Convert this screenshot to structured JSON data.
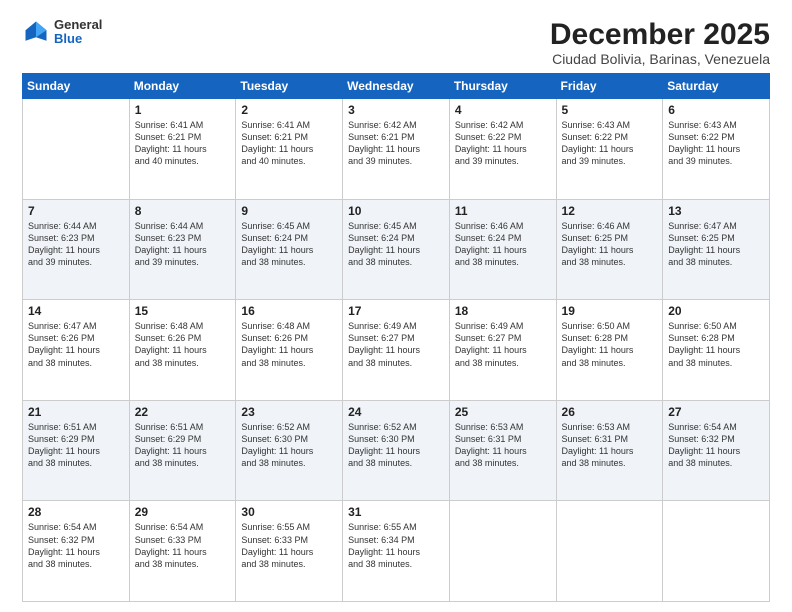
{
  "logo": {
    "general": "General",
    "blue": "Blue"
  },
  "title": "December 2025",
  "location": "Ciudad Bolivia, Barinas, Venezuela",
  "days_of_week": [
    "Sunday",
    "Monday",
    "Tuesday",
    "Wednesday",
    "Thursday",
    "Friday",
    "Saturday"
  ],
  "weeks": [
    [
      {
        "day": "",
        "sunrise": "",
        "sunset": "",
        "daylight": ""
      },
      {
        "day": "1",
        "sunrise": "Sunrise: 6:41 AM",
        "sunset": "Sunset: 6:21 PM",
        "daylight": "Daylight: 11 hours and 40 minutes."
      },
      {
        "day": "2",
        "sunrise": "Sunrise: 6:41 AM",
        "sunset": "Sunset: 6:21 PM",
        "daylight": "Daylight: 11 hours and 40 minutes."
      },
      {
        "day": "3",
        "sunrise": "Sunrise: 6:42 AM",
        "sunset": "Sunset: 6:21 PM",
        "daylight": "Daylight: 11 hours and 39 minutes."
      },
      {
        "day": "4",
        "sunrise": "Sunrise: 6:42 AM",
        "sunset": "Sunset: 6:22 PM",
        "daylight": "Daylight: 11 hours and 39 minutes."
      },
      {
        "day": "5",
        "sunrise": "Sunrise: 6:43 AM",
        "sunset": "Sunset: 6:22 PM",
        "daylight": "Daylight: 11 hours and 39 minutes."
      },
      {
        "day": "6",
        "sunrise": "Sunrise: 6:43 AM",
        "sunset": "Sunset: 6:22 PM",
        "daylight": "Daylight: 11 hours and 39 minutes."
      }
    ],
    [
      {
        "day": "7",
        "sunrise": "Sunrise: 6:44 AM",
        "sunset": "Sunset: 6:23 PM",
        "daylight": "Daylight: 11 hours and 39 minutes."
      },
      {
        "day": "8",
        "sunrise": "Sunrise: 6:44 AM",
        "sunset": "Sunset: 6:23 PM",
        "daylight": "Daylight: 11 hours and 39 minutes."
      },
      {
        "day": "9",
        "sunrise": "Sunrise: 6:45 AM",
        "sunset": "Sunset: 6:24 PM",
        "daylight": "Daylight: 11 hours and 38 minutes."
      },
      {
        "day": "10",
        "sunrise": "Sunrise: 6:45 AM",
        "sunset": "Sunset: 6:24 PM",
        "daylight": "Daylight: 11 hours and 38 minutes."
      },
      {
        "day": "11",
        "sunrise": "Sunrise: 6:46 AM",
        "sunset": "Sunset: 6:24 PM",
        "daylight": "Daylight: 11 hours and 38 minutes."
      },
      {
        "day": "12",
        "sunrise": "Sunrise: 6:46 AM",
        "sunset": "Sunset: 6:25 PM",
        "daylight": "Daylight: 11 hours and 38 minutes."
      },
      {
        "day": "13",
        "sunrise": "Sunrise: 6:47 AM",
        "sunset": "Sunset: 6:25 PM",
        "daylight": "Daylight: 11 hours and 38 minutes."
      }
    ],
    [
      {
        "day": "14",
        "sunrise": "Sunrise: 6:47 AM",
        "sunset": "Sunset: 6:26 PM",
        "daylight": "Daylight: 11 hours and 38 minutes."
      },
      {
        "day": "15",
        "sunrise": "Sunrise: 6:48 AM",
        "sunset": "Sunset: 6:26 PM",
        "daylight": "Daylight: 11 hours and 38 minutes."
      },
      {
        "day": "16",
        "sunrise": "Sunrise: 6:48 AM",
        "sunset": "Sunset: 6:26 PM",
        "daylight": "Daylight: 11 hours and 38 minutes."
      },
      {
        "day": "17",
        "sunrise": "Sunrise: 6:49 AM",
        "sunset": "Sunset: 6:27 PM",
        "daylight": "Daylight: 11 hours and 38 minutes."
      },
      {
        "day": "18",
        "sunrise": "Sunrise: 6:49 AM",
        "sunset": "Sunset: 6:27 PM",
        "daylight": "Daylight: 11 hours and 38 minutes."
      },
      {
        "day": "19",
        "sunrise": "Sunrise: 6:50 AM",
        "sunset": "Sunset: 6:28 PM",
        "daylight": "Daylight: 11 hours and 38 minutes."
      },
      {
        "day": "20",
        "sunrise": "Sunrise: 6:50 AM",
        "sunset": "Sunset: 6:28 PM",
        "daylight": "Daylight: 11 hours and 38 minutes."
      }
    ],
    [
      {
        "day": "21",
        "sunrise": "Sunrise: 6:51 AM",
        "sunset": "Sunset: 6:29 PM",
        "daylight": "Daylight: 11 hours and 38 minutes."
      },
      {
        "day": "22",
        "sunrise": "Sunrise: 6:51 AM",
        "sunset": "Sunset: 6:29 PM",
        "daylight": "Daylight: 11 hours and 38 minutes."
      },
      {
        "day": "23",
        "sunrise": "Sunrise: 6:52 AM",
        "sunset": "Sunset: 6:30 PM",
        "daylight": "Daylight: 11 hours and 38 minutes."
      },
      {
        "day": "24",
        "sunrise": "Sunrise: 6:52 AM",
        "sunset": "Sunset: 6:30 PM",
        "daylight": "Daylight: 11 hours and 38 minutes."
      },
      {
        "day": "25",
        "sunrise": "Sunrise: 6:53 AM",
        "sunset": "Sunset: 6:31 PM",
        "daylight": "Daylight: 11 hours and 38 minutes."
      },
      {
        "day": "26",
        "sunrise": "Sunrise: 6:53 AM",
        "sunset": "Sunset: 6:31 PM",
        "daylight": "Daylight: 11 hours and 38 minutes."
      },
      {
        "day": "27",
        "sunrise": "Sunrise: 6:54 AM",
        "sunset": "Sunset: 6:32 PM",
        "daylight": "Daylight: 11 hours and 38 minutes."
      }
    ],
    [
      {
        "day": "28",
        "sunrise": "Sunrise: 6:54 AM",
        "sunset": "Sunset: 6:32 PM",
        "daylight": "Daylight: 11 hours and 38 minutes."
      },
      {
        "day": "29",
        "sunrise": "Sunrise: 6:54 AM",
        "sunset": "Sunset: 6:33 PM",
        "daylight": "Daylight: 11 hours and 38 minutes."
      },
      {
        "day": "30",
        "sunrise": "Sunrise: 6:55 AM",
        "sunset": "Sunset: 6:33 PM",
        "daylight": "Daylight: 11 hours and 38 minutes."
      },
      {
        "day": "31",
        "sunrise": "Sunrise: 6:55 AM",
        "sunset": "Sunset: 6:34 PM",
        "daylight": "Daylight: 11 hours and 38 minutes."
      },
      {
        "day": "",
        "sunrise": "",
        "sunset": "",
        "daylight": ""
      },
      {
        "day": "",
        "sunrise": "",
        "sunset": "",
        "daylight": ""
      },
      {
        "day": "",
        "sunrise": "",
        "sunset": "",
        "daylight": ""
      }
    ]
  ]
}
